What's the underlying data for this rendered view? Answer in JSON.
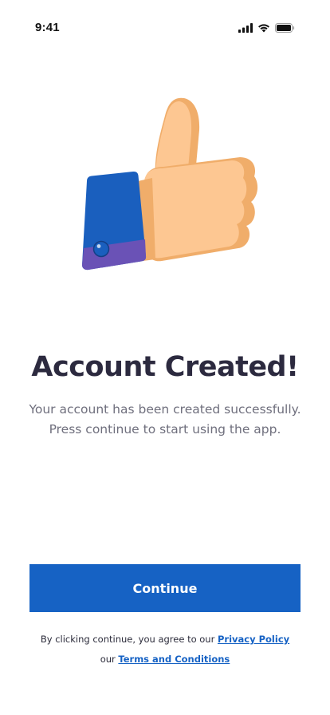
{
  "status_bar": {
    "time": "9:41",
    "icons": [
      "cellular-signal-icon",
      "wifi-icon",
      "battery-icon"
    ]
  },
  "illustration": {
    "name": "thumbs-up-icon",
    "colors": {
      "sleeve": "#1a5fbe",
      "cuff": "#6a52b6",
      "button": "#1a5fbe",
      "hand": "#fdc792",
      "hand_shadow": "#f0ad6a"
    }
  },
  "main": {
    "title": "Account Created!",
    "subtitle_line1": "Your account has been created successfully.",
    "subtitle_line2": "Press continue to start using the app."
  },
  "actions": {
    "continue_label": "Continue"
  },
  "legal": {
    "prefix": "By clicking continue, you agree to our ",
    "privacy_link": "Privacy Policy ",
    "middle": "our ",
    "terms_link": "Terms and Conditions"
  },
  "colors": {
    "accent": "#1662c4",
    "title": "#2c2a3f",
    "subtitle": "#6f6f7d"
  }
}
